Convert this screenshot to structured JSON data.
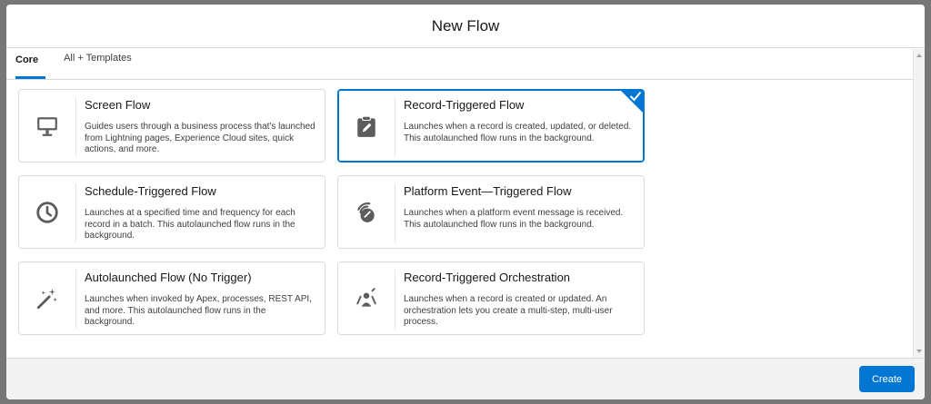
{
  "modal": {
    "title": "New Flow"
  },
  "tabs": [
    {
      "label": "Core",
      "active": true
    },
    {
      "label": "All + Templates",
      "active": false
    }
  ],
  "flow_types": [
    {
      "title": "Screen Flow",
      "description": "Guides users through a business process that's launched from Lightning pages, Experience Cloud sites, quick actions, and more.",
      "icon": "desktop-icon",
      "selected": false
    },
    {
      "title": "Record-Triggered Flow",
      "description": "Launches when a record is created, updated, or deleted. This autolaunched flow runs in the background.",
      "icon": "clipboard-edit-icon",
      "selected": true
    },
    {
      "title": "Schedule-Triggered Flow",
      "description": "Launches at a specified time and frequency for each record in a batch. This autolaunched flow runs in the background.",
      "icon": "clock-icon",
      "selected": false
    },
    {
      "title": "Platform Event—Triggered Flow",
      "description": "Launches when a platform event message is received. This autolaunched flow runs in the background.",
      "icon": "signal-icon",
      "selected": false
    },
    {
      "title": "Autolaunched Flow (No Trigger)",
      "description": "Launches when invoked by Apex, processes, REST API, and more. This autolaunched flow runs in the background.",
      "icon": "magic-wand-icon",
      "selected": false
    },
    {
      "title": "Record-Triggered Orchestration",
      "description": "Launches when a record is created or updated. An orchestration lets you create a multi-step, multi-user process.",
      "icon": "orchestration-icon",
      "selected": false
    }
  ],
  "footer": {
    "create_label": "Create"
  },
  "colors": {
    "brand": "#0176d3",
    "icon": "#5c5c5c",
    "backdrop": "#777777"
  }
}
